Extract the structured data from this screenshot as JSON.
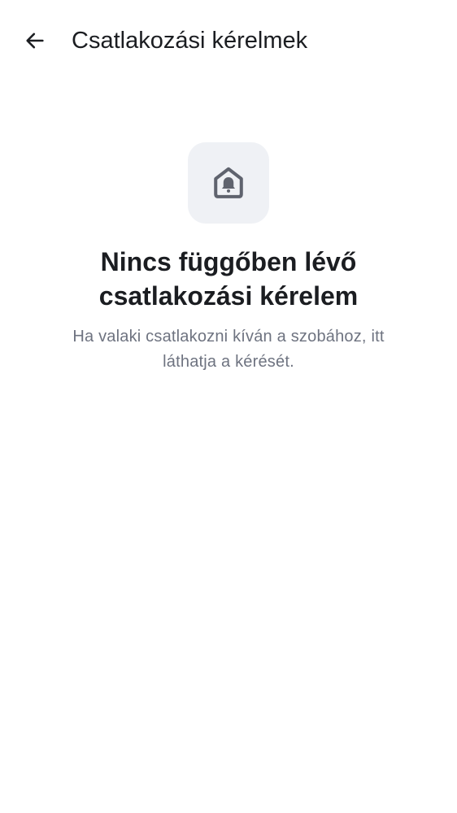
{
  "header": {
    "back_icon": "arrow-left-icon",
    "title": "Csatlakozási kérelmek"
  },
  "empty_state": {
    "icon": "home-bell-icon",
    "title": "Nincs függőben lévő csatlakozási kérelem",
    "subtitle": "Ha valaki csatlakozni kíván a szobához, itt láthatja a kérését."
  },
  "colors": {
    "text_primary": "#1b1d21",
    "text_secondary": "#6e7380",
    "icon_tile_bg": "#eff1f5",
    "icon_color": "#5f636e",
    "background": "#ffffff"
  }
}
